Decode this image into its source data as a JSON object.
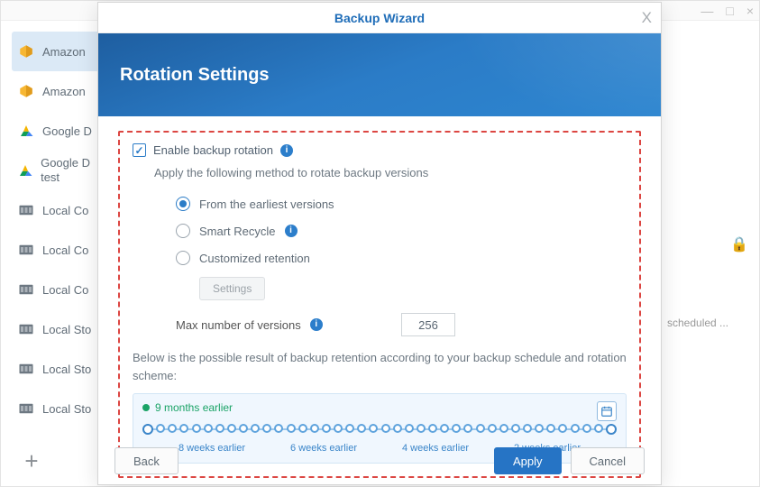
{
  "parent_window": {
    "minimize": "—",
    "maximize": "□",
    "close": "×"
  },
  "sidebar": {
    "items": [
      {
        "label": "Amazon",
        "icon": "amazon-icon"
      },
      {
        "label": "Amazon",
        "icon": "amazon-icon"
      },
      {
        "label": "Google D",
        "icon": "google-drive-icon"
      },
      {
        "label": "Google D test",
        "icon": "google-drive-icon"
      },
      {
        "label": "Local Co",
        "icon": "storage-icon"
      },
      {
        "label": "Local Co",
        "icon": "storage-icon"
      },
      {
        "label": "Local Co",
        "icon": "storage-icon"
      },
      {
        "label": "Local Sto",
        "icon": "storage-icon"
      },
      {
        "label": "Local Sto",
        "icon": "storage-icon"
      },
      {
        "label": "Local Sto",
        "icon": "storage-icon"
      }
    ],
    "add": "+"
  },
  "right_meta": {
    "lock": "🔒",
    "scheduled": "scheduled ..."
  },
  "modal": {
    "title": "Backup Wizard",
    "close": "X",
    "heading": "Rotation Settings",
    "enable_label": "Enable backup rotation",
    "apply_text": "Apply the following method to rotate backup versions",
    "radios": {
      "earliest": "From the earliest versions",
      "smart": "Smart Recycle",
      "custom": "Customized retention"
    },
    "settings_btn": "Settings",
    "max_versions_label": "Max number of versions",
    "max_versions_value": "256",
    "below_text": "Below is the possible result of backup retention according to your backup schedule and rotation scheme:",
    "timeline": {
      "nine_months": "9 months earlier",
      "ticks": [
        "8 weeks earlier",
        "6 weeks earlier",
        "4 weeks earlier",
        "2 weeks earlier"
      ]
    },
    "footer": {
      "back": "Back",
      "apply": "Apply",
      "cancel": "Cancel"
    }
  }
}
